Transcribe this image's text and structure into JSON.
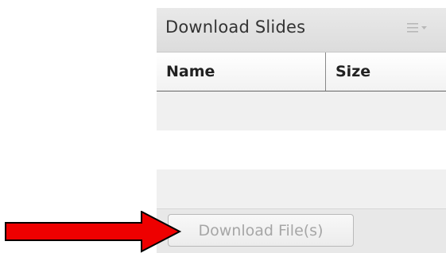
{
  "panel": {
    "title": "Download Slides",
    "menu_icon": "list-menu-icon"
  },
  "table": {
    "columns": [
      "Name",
      "Size"
    ],
    "rows": []
  },
  "footer": {
    "download_button_label": "Download File(s)",
    "download_button_enabled": false
  },
  "annotation": {
    "arrow_icon": "red-arrow-icon",
    "arrow_color": "#ee0000"
  }
}
